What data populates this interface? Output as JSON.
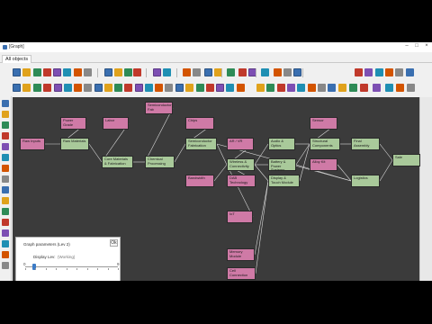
{
  "window": {
    "title": "[Graph]"
  },
  "tabs": [
    {
      "label": "All objects"
    }
  ],
  "colors": {
    "material_node": "#cf7aa6",
    "process_node": "#a9c99a",
    "canvas": "#3b3b3b",
    "edge": "#d9d9d9"
  },
  "toolbar1": {
    "icons": [
      "select-icon",
      "move-icon",
      "zoom-in-icon",
      "zoom-out-icon",
      "search-icon",
      "text-icon",
      "find-icon",
      "comment-icon",
      "node-add-icon",
      "node-add-alt-icon",
      "sort-icon",
      "edit-icon",
      "filter-icon",
      "collapse-icon",
      "expand-icon",
      "add-icon",
      "attach-icon",
      "link-icon",
      "clipboard-icon",
      "home-icon",
      "grid-icon",
      "close-icon",
      "stop-icon",
      "screen-icon",
      "error-icon"
    ]
  },
  "toolbar2": {
    "icons": [
      "star-icon",
      "pin-icon",
      "layout-h-icon",
      "layout-v-icon",
      "scissors-icon",
      "copy-icon",
      "paste-icon",
      "save-icon",
      "align-left-icon",
      "align-right-icon",
      "align-top-icon",
      "align-bottom-icon",
      "distribute-h-icon",
      "distribute-v-icon",
      "grid-snap-icon",
      "table-icon",
      "image-icon",
      "swap-icon",
      "zoom-fit-icon",
      "print-icon",
      "hand-icon",
      "export-icon",
      "settings-icon"
    ]
  },
  "lefttoolbar": {
    "icons": [
      "close-icon",
      "branch-icon",
      "expand-icon",
      "tree-icon",
      "network-icon",
      "chain-icon",
      "graph-icon",
      "hierarchy-icon",
      "cluster-icon",
      "network-alt-icon",
      "folder-icon",
      "chart-icon",
      "table-icon",
      "image-icon",
      "pencil-icon",
      "list-icon"
    ]
  },
  "nodes": [
    {
      "id": "n1",
      "label": "Raw Inputs",
      "kind": "material"
    },
    {
      "id": "n2",
      "label": "Power Grade",
      "kind": "material"
    },
    {
      "id": "n3",
      "label": "Raw Materials",
      "kind": "process"
    },
    {
      "id": "n4",
      "label": "Labor",
      "kind": "material"
    },
    {
      "id": "n5",
      "label": "Core Materials\n& Fabrication",
      "kind": "process"
    },
    {
      "id": "n6",
      "label": "Semiconductor\nFab",
      "kind": "material"
    },
    {
      "id": "n7",
      "label": "Chemical\nProcessing",
      "kind": "process"
    },
    {
      "id": "n8",
      "label": "Chips",
      "kind": "material"
    },
    {
      "id": "n9",
      "label": "Semiconductor\nFabrication",
      "kind": "process"
    },
    {
      "id": "n10",
      "label": "Bandwidth",
      "kind": "material"
    },
    {
      "id": "n11",
      "label": "AR / VR",
      "kind": "material"
    },
    {
      "id": "n12",
      "label": "Wireless &\nConnectivity",
      "kind": "process"
    },
    {
      "id": "n13",
      "label": "DAB\nTechnology",
      "kind": "material"
    },
    {
      "id": "n14",
      "label": "IoT",
      "kind": "material"
    },
    {
      "id": "n15",
      "label": "Memory\nModule",
      "kind": "material"
    },
    {
      "id": "n16",
      "label": "Cell\nConnection",
      "kind": "material"
    },
    {
      "id": "n17",
      "label": "Audio &\nOptics",
      "kind": "process"
    },
    {
      "id": "n18",
      "label": "Battery &\nPower Systems",
      "kind": "process"
    },
    {
      "id": "n19",
      "label": "Display &\nTouch Module",
      "kind": "process"
    },
    {
      "id": "n20",
      "label": "Sensor",
      "kind": "material"
    },
    {
      "id": "n21",
      "label": "Structural\nComponents",
      "kind": "process"
    },
    {
      "id": "n22",
      "label": "Alloy Kit",
      "kind": "material"
    },
    {
      "id": "n23",
      "label": "Final Assembly",
      "kind": "process"
    },
    {
      "id": "n24",
      "label": "Logistics",
      "kind": "process"
    },
    {
      "id": "n25",
      "label": "Sale",
      "kind": "process"
    }
  ],
  "edges": [
    [
      "n1",
      "n3"
    ],
    [
      "n2",
      "n3"
    ],
    [
      "n3",
      "n5"
    ],
    [
      "n4",
      "n5"
    ],
    [
      "n5",
      "n7"
    ],
    [
      "n6",
      "n7"
    ],
    [
      "n7",
      "n9"
    ],
    [
      "n8",
      "n9"
    ],
    [
      "n9",
      "n12"
    ],
    [
      "n10",
      "n12"
    ],
    [
      "n11",
      "n12"
    ],
    [
      "n12",
      "n17"
    ],
    [
      "n12",
      "n18"
    ],
    [
      "n12",
      "n19"
    ],
    [
      "n13",
      "n12"
    ],
    [
      "n14",
      "n12"
    ],
    [
      "n15",
      "n19"
    ],
    [
      "n16",
      "n19"
    ],
    [
      "n17",
      "n21"
    ],
    [
      "n18",
      "n21"
    ],
    [
      "n19",
      "n21"
    ],
    [
      "n20",
      "n21"
    ],
    [
      "n21",
      "n23"
    ],
    [
      "n22",
      "n24"
    ],
    [
      "n23",
      "n25"
    ],
    [
      "n24",
      "n25"
    ],
    [
      "n9",
      "n24"
    ],
    [
      "n18",
      "n24"
    ]
  ],
  "panel": {
    "title": "Graph parameters (Lev 2)",
    "close": "Ok",
    "slider_label": "Display Lev:",
    "slider_value": "(Working)",
    "slider_min": "0",
    "slider_max": "9",
    "slider_level": 0.1
  }
}
